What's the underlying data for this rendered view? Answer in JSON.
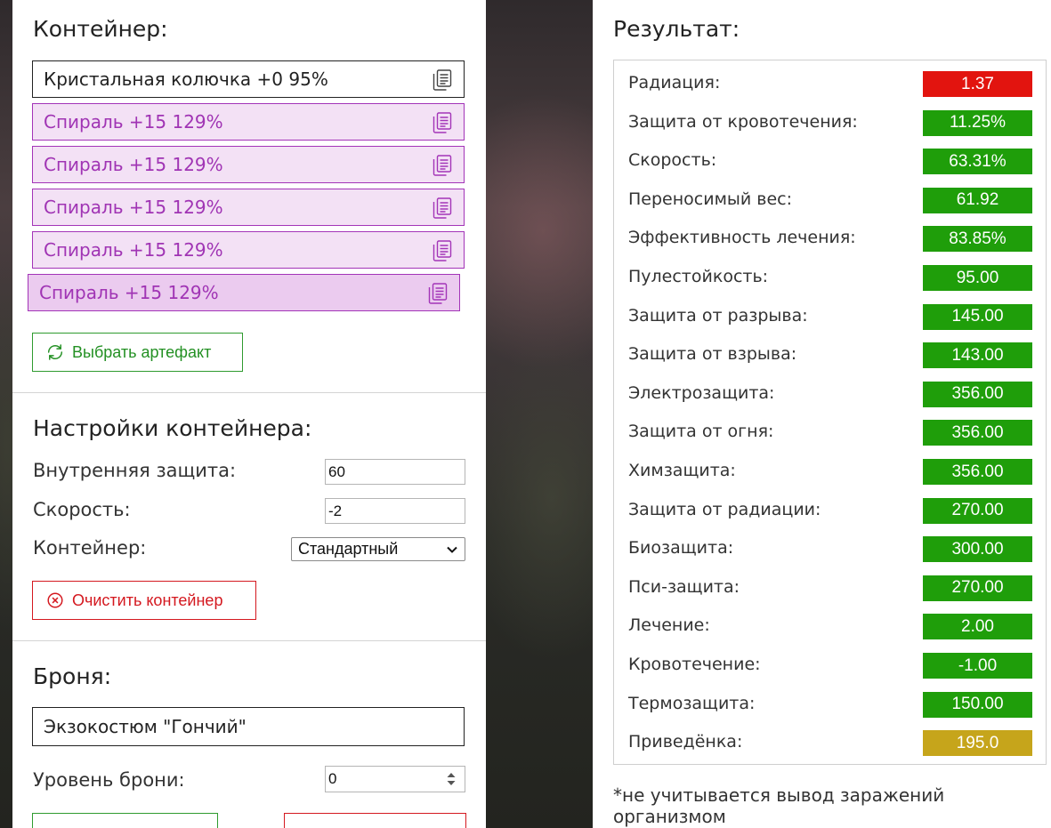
{
  "colors": {
    "good": "#1f9e0a",
    "bad": "#e2140f",
    "special": "#c6a51b",
    "spiral_border": "#a334b8",
    "green_button": "#239023",
    "red_button": "#d4181f"
  },
  "container": {
    "title": "Контейнер:",
    "slots": [
      {
        "label": "Кристальная колючка +0 95%",
        "type": "crystal",
        "icon": "document-icon"
      },
      {
        "label": "Спираль +15 129%",
        "type": "spiral",
        "icon": "document-icon"
      },
      {
        "label": "Спираль +15 129%",
        "type": "spiral",
        "icon": "document-icon"
      },
      {
        "label": "Спираль +15 129%",
        "type": "spiral",
        "icon": "document-icon"
      },
      {
        "label": "Спираль +15 129%",
        "type": "spiral",
        "icon": "document-icon"
      },
      {
        "label": "Спираль +15 129%",
        "type": "spiral",
        "icon": "document-icon"
      }
    ],
    "choose_button": "Выбрать артефакт",
    "choose_icon": "refresh-icon"
  },
  "settings": {
    "title": "Настройки контейнера:",
    "inner_protection_label": "Внутренняя защита:",
    "inner_protection_value": "60",
    "speed_label": "Скорость:",
    "speed_value": "-2",
    "container_label": "Контейнер:",
    "container_selected": "Стандартный",
    "clear_button": "Очистить контейнер",
    "clear_icon": "close-circle-icon"
  },
  "armor": {
    "title": "Броня:",
    "selected": "Экзокостюм \"Гончий\"",
    "level_label": "Уровень брони:",
    "level_value": "0"
  },
  "result": {
    "title": "Результат:",
    "rows": [
      {
        "label": "Радиация:",
        "value": "1.37",
        "status": "bad"
      },
      {
        "label": "Защита от кровотечения:",
        "value": "11.25%",
        "status": "good"
      },
      {
        "label": "Скорость:",
        "value": "63.31%",
        "status": "good"
      },
      {
        "label": "Переносимый вес:",
        "value": "61.92",
        "status": "good"
      },
      {
        "label": "Эффективность лечения:",
        "value": "83.85%",
        "status": "good"
      },
      {
        "label": "Пулестойкость:",
        "value": "95.00",
        "status": "good"
      },
      {
        "label": "Защита от разрыва:",
        "value": "145.00",
        "status": "good"
      },
      {
        "label": "Защита от взрыва:",
        "value": "143.00",
        "status": "good"
      },
      {
        "label": "Электрозащита:",
        "value": "356.00",
        "status": "good"
      },
      {
        "label": "Защита от огня:",
        "value": "356.00",
        "status": "good"
      },
      {
        "label": "Химзащита:",
        "value": "356.00",
        "status": "good"
      },
      {
        "label": "Защита от радиации:",
        "value": "270.00",
        "status": "good"
      },
      {
        "label": "Биозащита:",
        "value": "300.00",
        "status": "good"
      },
      {
        "label": "Пси-защита:",
        "value": "270.00",
        "status": "good"
      },
      {
        "label": "Лечение:",
        "value": "2.00",
        "status": "good"
      },
      {
        "label": "Кровотечение:",
        "value": "-1.00",
        "status": "good"
      },
      {
        "label": "Термозащита:",
        "value": "150.00",
        "status": "good"
      },
      {
        "label": "Приведёнка:",
        "value": "195.0",
        "status": "special"
      }
    ],
    "note": "*не учитывается вывод заражений организмом"
  }
}
